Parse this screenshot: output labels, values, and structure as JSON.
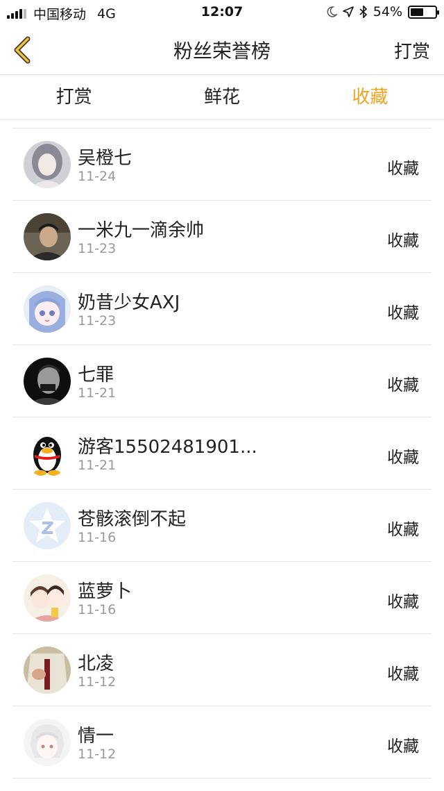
{
  "status_bar": {
    "carrier": "中国移动",
    "network": "4G",
    "time": "12:07",
    "battery": "54%",
    "battery_level": 0.54
  },
  "nav": {
    "back_icon": "chevron-left-icon",
    "title": "粉丝荣誉榜",
    "right_label": "打赏"
  },
  "tabs": [
    {
      "label": "打赏",
      "active": false
    },
    {
      "label": "鲜花",
      "active": false
    },
    {
      "label": "收藏",
      "active": true
    }
  ],
  "colors": {
    "accent": "#f0a31f",
    "divider": "#e6e6e6",
    "secondary_text": "#999999"
  },
  "fans": [
    {
      "name": "吴橙七",
      "date": "11-24",
      "action": "收藏"
    },
    {
      "name": "一米九一滴余帅",
      "date": "11-23",
      "action": "收藏"
    },
    {
      "name": "奶昔少女AXJ",
      "date": "11-23",
      "action": "收藏"
    },
    {
      "name": "七罪",
      "date": "11-21",
      "action": "收藏"
    },
    {
      "name": "游客15502481901...",
      "date": "11-21",
      "action": "收藏"
    },
    {
      "name": "苍骸滚倒不起",
      "date": "11-16",
      "action": "收藏"
    },
    {
      "name": "蓝萝卜",
      "date": "11-16",
      "action": "收藏"
    },
    {
      "name": "北凌",
      "date": "11-12",
      "action": "收藏"
    },
    {
      "name": "情一",
      "date": "11-12",
      "action": "收藏"
    }
  ]
}
